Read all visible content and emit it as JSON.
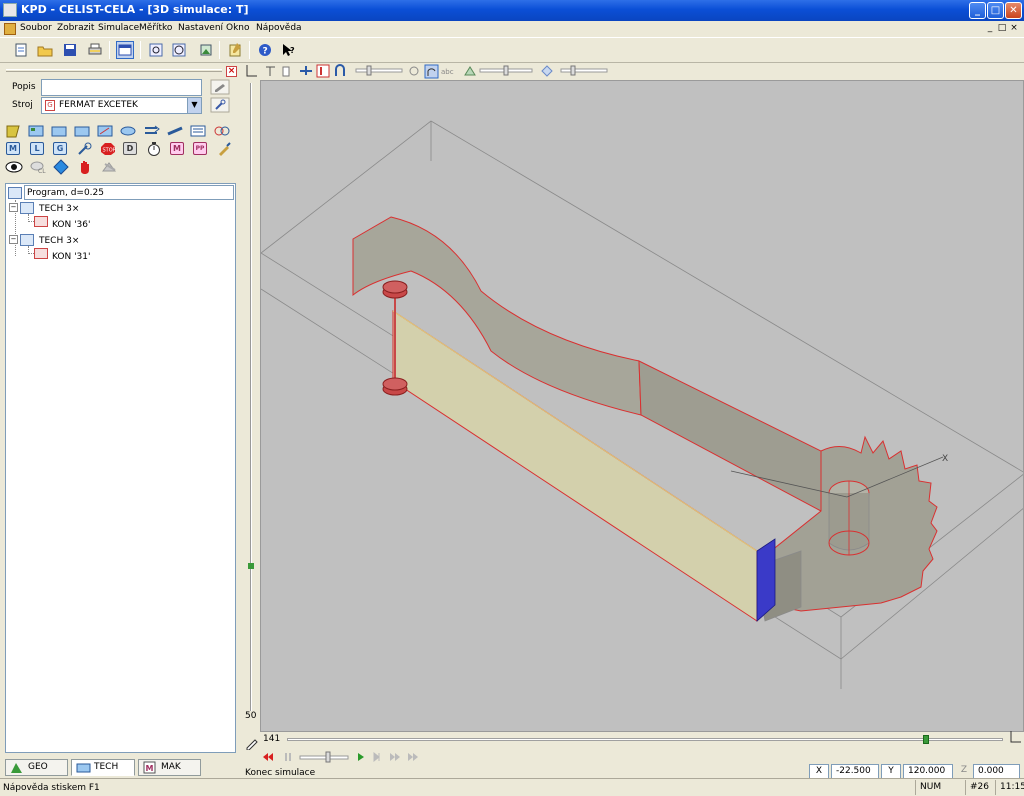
{
  "window": {
    "title": "KPD - CELIST-CELA - [3D simulace: T]",
    "controls": [
      "_",
      "□",
      "✕"
    ]
  },
  "menu": {
    "items": [
      "Soubor",
      "Zobrazit",
      "Simulace",
      "Měřítko",
      "Nastavení",
      "Okno",
      "Nápověda"
    ],
    "mdi_controls": [
      "_",
      "□",
      "×"
    ]
  },
  "left_panel": {
    "popis_label": "Popis",
    "popis_value": "",
    "stroj_label": "Stroj",
    "stroj_value": "FERMAT EXCETEK",
    "tool_letters": [
      "M",
      "L",
      "G",
      "D",
      "M",
      "PP"
    ],
    "tree": [
      {
        "label": "Program, d=0.25",
        "level": 0
      },
      {
        "label": "TECH 3×",
        "level": 1
      },
      {
        "label": "KON '36'",
        "level": 2
      },
      {
        "label": "TECH 3×",
        "level": 1
      },
      {
        "label": "KON '31'",
        "level": 2
      }
    ],
    "tabs": [
      "GEO",
      "TECH",
      "MAK"
    ],
    "active_tab": "TECH"
  },
  "viewport": {
    "axis_label": "X",
    "side_value": "50",
    "frame_value": "141",
    "sim_status": "Konec simulace",
    "coordinates": {
      "x_label": "X",
      "x_value": "-22.500",
      "y_label": "Y",
      "y_value": "120.000",
      "z_label": "Z",
      "z_value": "0.000"
    }
  },
  "status_bar": {
    "help_text": "Nápověda stiskem F1",
    "num": "NUM",
    "record": "#26",
    "time": "11:15"
  },
  "colors": {
    "title_bar": "#0b4fd6",
    "chrome": "#ece9d8",
    "viewport_bg": "#c0c0c0",
    "part_wall": "#a7a69a",
    "part_outline": "#d93030",
    "cut_face": "#3a3ac8",
    "wire_marker": "#c84848"
  }
}
